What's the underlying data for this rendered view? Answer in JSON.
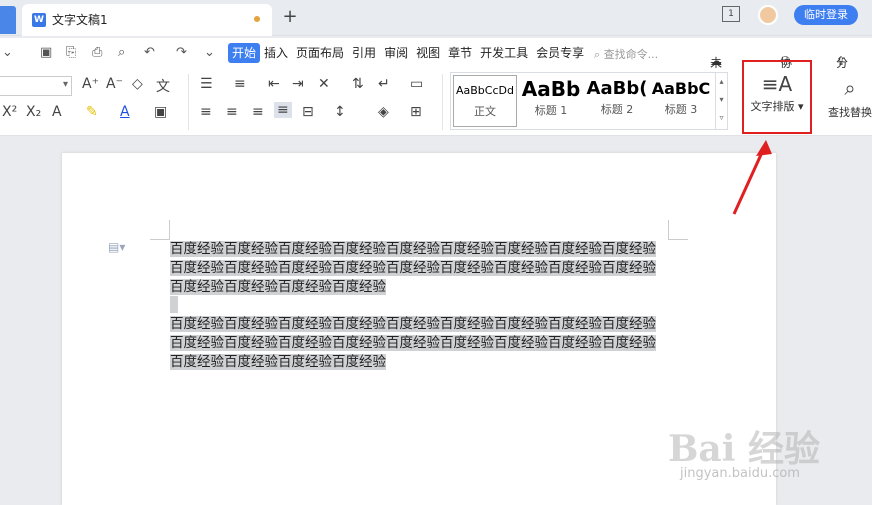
{
  "tabbar": {
    "doc_icon_letter": "W",
    "doc_title": "文字文稿1",
    "new_tab": "+",
    "page_badge": "1",
    "login_label": "临时登录"
  },
  "menu": {
    "tabs": [
      "开始",
      "插入",
      "页面布局",
      "引用",
      "审阅",
      "视图",
      "章节",
      "开发工具",
      "会员专享"
    ],
    "active_tab": "开始",
    "search_placeholder": "查找命令...",
    "unsaved": "未保存",
    "collab": "协作",
    "share": "分享"
  },
  "styles": [
    {
      "sample": "AaBbCcDd",
      "label": "正文"
    },
    {
      "sample": "AaBb",
      "label": "标题 1"
    },
    {
      "sample": "AaBb(",
      "label": "标题 2"
    },
    {
      "sample": "AaBbC",
      "label": "标题 3"
    }
  ],
  "ribbon_right": {
    "text_layout": "文字排版",
    "find_replace": "查找替换"
  },
  "document": {
    "para1": "百度经验百度经验百度经验百度经验百度经验百度经验百度经验百度经验百度经验百度经验百度经验百度经验百度经验百度经验百度经验百度经验百度经验百度经验百度经验百度经验百度经验百度经验",
    "para2": "百度经验百度经验百度经验百度经验百度经验百度经验百度经验百度经验百度经验百度经验百度经验百度经验百度经验百度经验百度经验百度经验百度经验百度经验百度经验百度经验百度经验百度经验"
  },
  "watermark": {
    "logo": "Bai  经验",
    "url": "jingyan.baidu.com"
  },
  "colors": {
    "accent": "#3d7ef0",
    "highlight_box": "#e02020",
    "selection": "#cfd1d4"
  }
}
